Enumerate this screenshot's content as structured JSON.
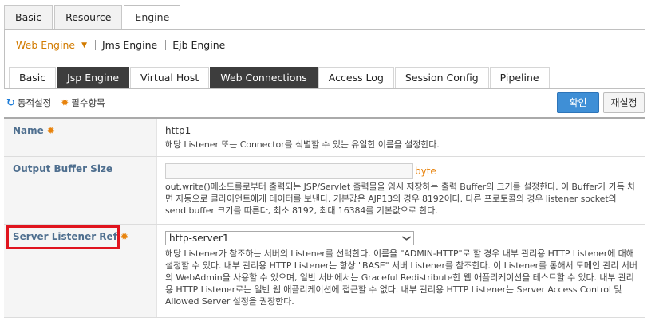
{
  "top_tabs": [
    "Basic",
    "Resource",
    "Engine"
  ],
  "engine_nav": {
    "items": [
      "Web Engine",
      "Jms Engine",
      "Ejb Engine"
    ],
    "active": "Web Engine"
  },
  "sub_tabs": [
    "Basic",
    "Jsp Engine",
    "Virtual Host",
    "Web Connections",
    "Access Log",
    "Session Config",
    "Pipeline"
  ],
  "legend": {
    "dynamic": "동적설정",
    "required": "필수항목"
  },
  "buttons": {
    "ok": "확인",
    "reset": "재설정"
  },
  "form": {
    "name": {
      "label": "Name",
      "value": "http1",
      "desc": "해당 Listener 또는 Connector를 식별할 수 있는 유일한 이름을 설정한다."
    },
    "output_buffer": {
      "label": "Output Buffer Size",
      "value": "",
      "unit": "byte",
      "desc": "out.write()메소드를로부터 출력되는 JSP/Servlet 출력물을 임시 저장하는 출력 Buffer의 크기를 설정한다. 이 Buffer가 가득 차면 자동으로 클라이언트에게 데이터를 보낸다. 기본값은 AJP13의 경우 8192이다. 다른 프로토콜의 경우 listener socket의 send buffer 크기를 따른다, 최소 8192, 최대 16384를 기본값으로 한다."
    },
    "server_listener": {
      "label": "Server Listener Ref",
      "value": "http-server1",
      "desc": "해당 Listener가 참조하는 서버의 Listener를 선택한다. 이름을 \"ADMIN-HTTP\"로 할 경우 내부 관리용 HTTP Listener에 대해 설정할 수 있다. 내부 관리용 HTTP Listener는 항상 \"BASE\" 서버 Listener를 참조한다. 이 Listener를 통해서 도메인 관리 서버의 WebAdmin을 사용할 수 있으며, 일반 서버에서는 Graceful Redistribute한 웹 애플리케이션을 테스트할 수 있다. 내부 관리용 HTTP Listener로는 일반 웹 애플리케이션에 접근할 수 없다. 내부 관리용 HTTP Listener는 Server Access Control 및 Allowed Server 설정을 권장한다."
    }
  },
  "colors": {
    "accent_orange": "#d27b00",
    "primary_blue": "#3f8fd6",
    "highlight_red": "#e0141e"
  }
}
